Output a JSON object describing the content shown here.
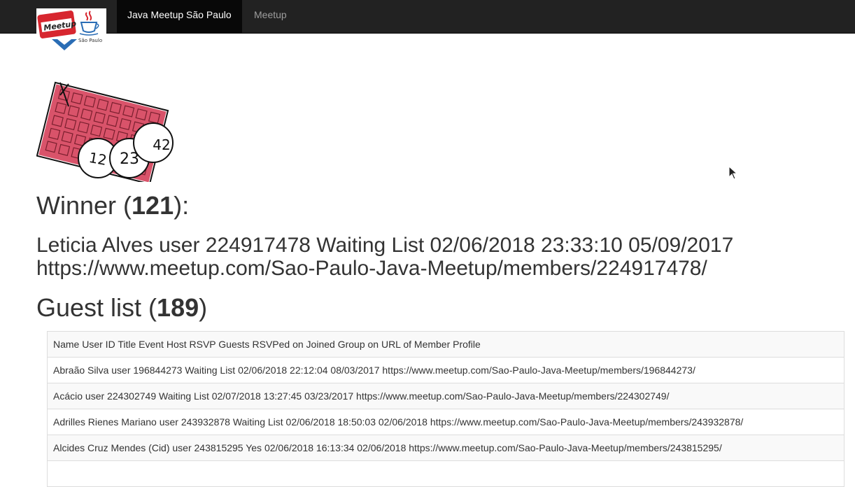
{
  "navbar": {
    "brand_logo": {
      "badge_text": "Meetup",
      "city_text": "São Paulo",
      "icon": "java-coffee-cup-icon"
    },
    "active_label": "Java Meetup São Paulo",
    "link_label": "Meetup"
  },
  "hero": {
    "icon": "bingo-card-icon",
    "ball_numbers": [
      "12",
      "23",
      "42"
    ]
  },
  "winner": {
    "prefix": "Winner (",
    "count": "121",
    "suffix": "):",
    "line1": "Leticia Alves user 224917478 Waiting List 02/06/2018 23:33:10 05/09/2017",
    "line2": "https://www.meetup.com/Sao-Paulo-Java-Meetup/members/224917478/"
  },
  "guests": {
    "prefix": "Guest list (",
    "count": "189",
    "suffix": ")",
    "header": "Name User ID Title Event Host RSVP Guests RSVPed on Joined Group on URL of Member Profile",
    "rows": [
      "Abraão Silva user 196844273 Waiting List 02/06/2018 22:12:04 08/03/2017 https://www.meetup.com/Sao-Paulo-Java-Meetup/members/196844273/",
      "Acácio user 224302749 Waiting List 02/07/2018 13:27:45 03/23/2017 https://www.meetup.com/Sao-Paulo-Java-Meetup/members/224302749/",
      "Adrilles Rienes Mariano user 243932878 Waiting List 02/06/2018 18:50:03 02/06/2018 https://www.meetup.com/Sao-Paulo-Java-Meetup/members/243932878/",
      "Alcides Cruz Mendes (Cid) user 243815295 Yes 02/06/2018 16:13:34 02/06/2018 https://www.meetup.com/Sao-Paulo-Java-Meetup/members/243815295/"
    ]
  },
  "colors": {
    "navbar_bg": "#222222",
    "nav_active_bg": "#080808",
    "card_red": "#d9536a",
    "logo_blue": "#2a6db5"
  }
}
